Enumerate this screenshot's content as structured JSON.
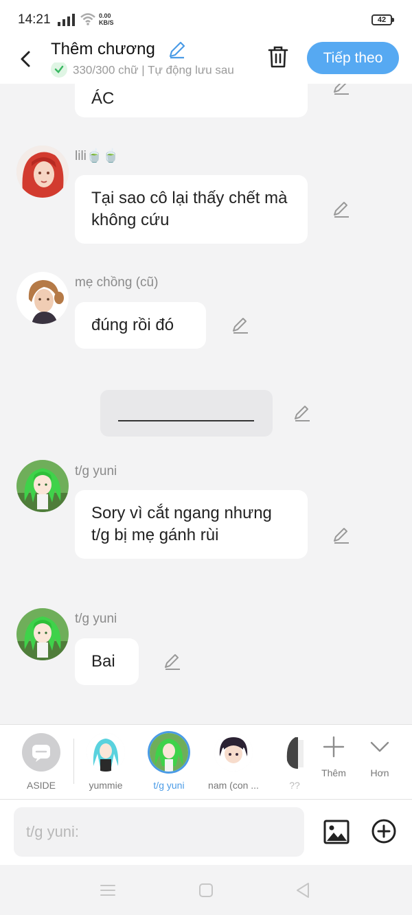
{
  "status_bar": {
    "time": "14:21",
    "net_speed_value": "0.00",
    "net_speed_unit": "KB/S",
    "battery": "42"
  },
  "header": {
    "title": "Thêm chương",
    "subtitle": "330/300 chữ | Tự động lưu sau",
    "next_label": "Tiếp theo"
  },
  "messages": [
    {
      "sender": "",
      "text": "ÁC"
    },
    {
      "sender": "lili🍵🍵",
      "text": "Tại sao cô lại thấy chết mà không cứu"
    },
    {
      "sender": "mẹ chồng (cũ)",
      "text": "đúng rồi đó"
    },
    {
      "sender": "",
      "text": ""
    },
    {
      "sender": "t/g yuni",
      "text": "Sory vì  cắt ngang nhưng t/g bị mẹ gánh rùi"
    },
    {
      "sender": "t/g yuni",
      "text": "Bai"
    }
  ],
  "characters": [
    {
      "label": "ASIDE"
    },
    {
      "label": "yummie"
    },
    {
      "label": "t/g yuni"
    },
    {
      "label": "nam (con ..."
    },
    {
      "label": "??"
    }
  ],
  "tools": {
    "add_label": "Thêm",
    "more_label": "Hơn"
  },
  "input": {
    "placeholder": "t/g yuni:"
  },
  "colors": {
    "accent": "#56a9f2",
    "selected_label": "#4a9be6",
    "bubble": "#ffffff",
    "background": "#f3f3f4"
  }
}
